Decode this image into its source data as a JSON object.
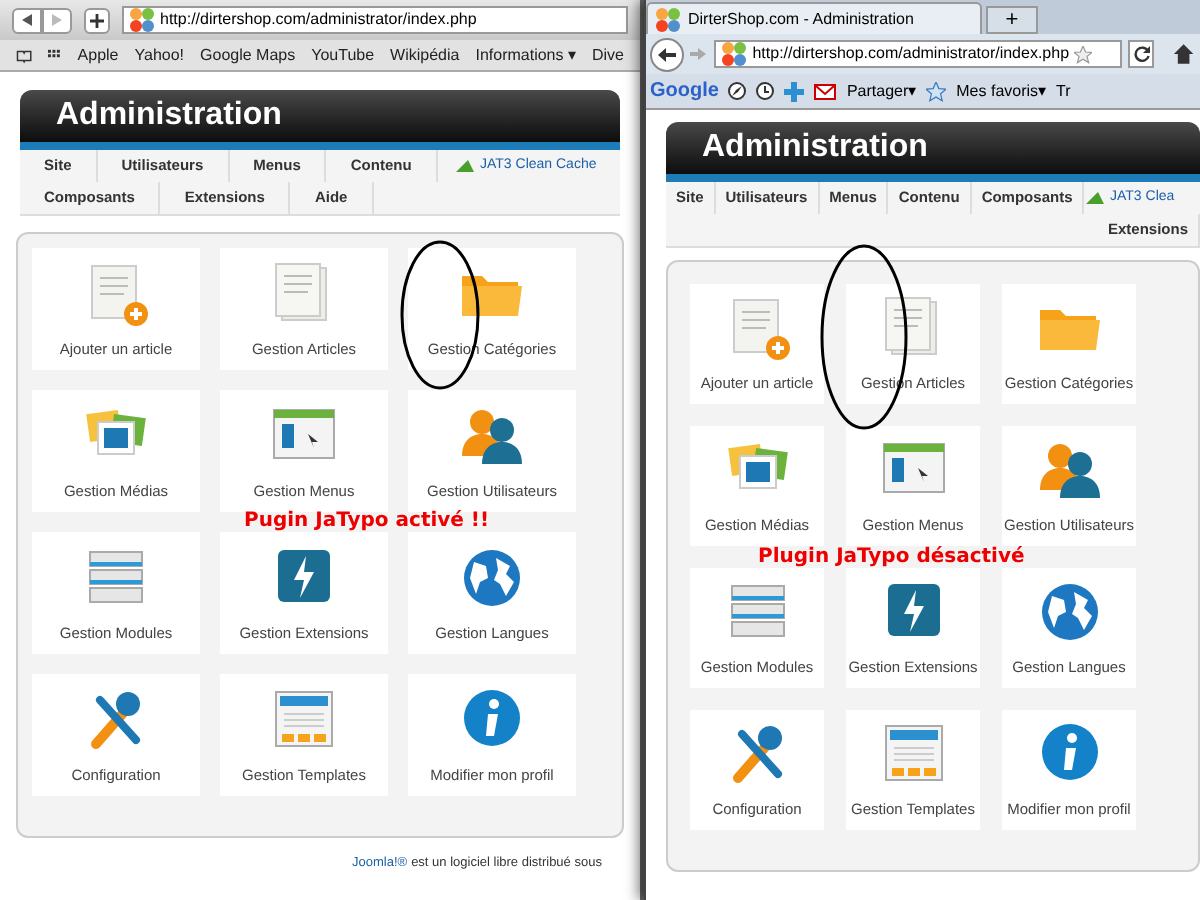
{
  "windows": [
    {
      "kind": "safari",
      "url": "http://dirtershop.com/administrator/index.php",
      "bookmarks": [
        "Apple",
        "Yahoo!",
        "Google Maps",
        "YouTube",
        "Wikipédia",
        "Informations ▾",
        "Dive"
      ],
      "header": "Administration",
      "menu_rows": [
        [
          "Site",
          "Utilisateurs",
          "Menus",
          "Contenu"
        ],
        [
          "Composants",
          "Extensions",
          "Aide"
        ]
      ],
      "cache_link": "JAT3 Clean Cache",
      "items": [
        {
          "kind": "add-article",
          "label": "Ajouter un article"
        },
        {
          "kind": "article",
          "label": "Gestion Articles"
        },
        {
          "kind": "folder",
          "label": "Gestion Catégories"
        },
        {
          "kind": "media",
          "label": "Gestion Médias"
        },
        {
          "kind": "menu",
          "label": "Gestion Menus"
        },
        {
          "kind": "users",
          "label": "Gestion Utilisateurs"
        },
        {
          "kind": "modules",
          "label": "Gestion Modules"
        },
        {
          "kind": "extensions",
          "label": "Gestion Extensions"
        },
        {
          "kind": "languages",
          "label": "Gestion Langues"
        },
        {
          "kind": "config",
          "label": "Configuration"
        },
        {
          "kind": "templates",
          "label": "Gestion Templates"
        },
        {
          "kind": "profile",
          "label": "Modifier mon profil"
        }
      ],
      "note": "Pugin JaTypo activé !!",
      "footer": {
        "link": "Joomla!®",
        "text": "est un logiciel libre distribué sous"
      }
    },
    {
      "kind": "firefox",
      "tab_title": "DirterShop.com - Administration",
      "new_tab": "+",
      "url": "http://dirtershop.com/administrator/index.php",
      "toolbar": {
        "logo": "Google",
        "share": "Partager▾",
        "favorites": "Mes favoris▾",
        "cut": "Tr"
      },
      "header": "Administration",
      "menu_rows": [
        [
          "Site",
          "Utilisateurs",
          "Menus",
          "Contenu",
          "Composants"
        ],
        [
          "Extensions"
        ]
      ],
      "cache_link": "JAT3 Clea",
      "items": [
        {
          "kind": "add-article",
          "label": "Ajouter un article"
        },
        {
          "kind": "article",
          "label": "Gestion Articles"
        },
        {
          "kind": "folder",
          "label": "Gestion Catégories"
        },
        {
          "kind": "media",
          "label": "Gestion Médias"
        },
        {
          "kind": "menu",
          "label": "Gestion Menus"
        },
        {
          "kind": "users",
          "label": "Gestion Utilisateurs"
        },
        {
          "kind": "modules",
          "label": "Gestion Modules"
        },
        {
          "kind": "extensions",
          "label": "Gestion Extensions"
        },
        {
          "kind": "languages",
          "label": "Gestion Langues"
        },
        {
          "kind": "config",
          "label": "Configuration"
        },
        {
          "kind": "templates",
          "label": "Gestion Templates"
        },
        {
          "kind": "profile",
          "label": "Modifier mon profil"
        }
      ],
      "note": "Plugin JaTypo désactivé"
    }
  ]
}
